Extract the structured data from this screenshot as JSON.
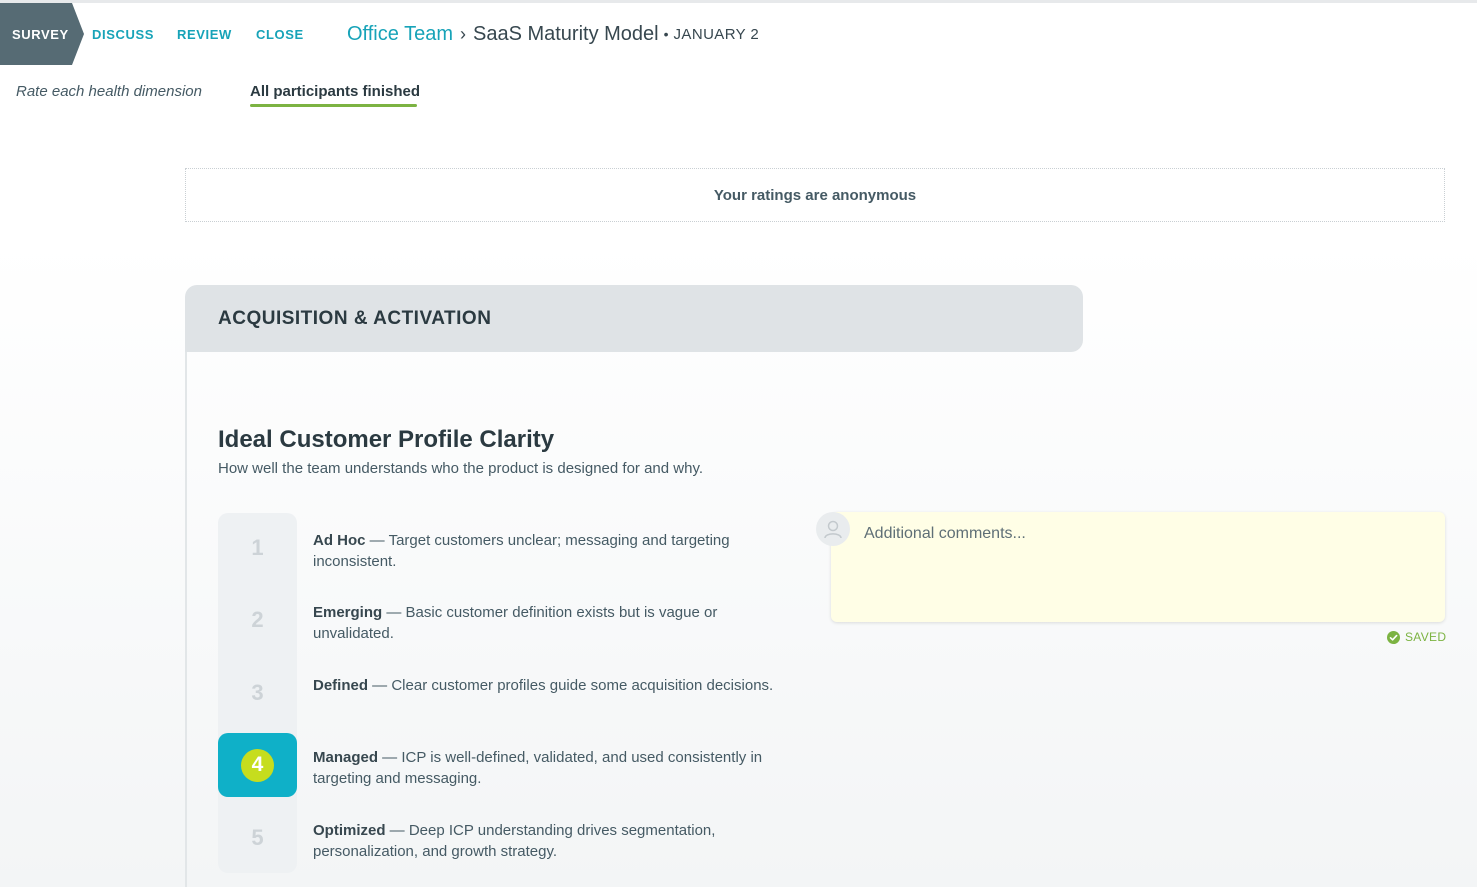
{
  "nav": {
    "steps": [
      {
        "label": "SURVEY"
      },
      {
        "label": "DISCUSS"
      },
      {
        "label": "REVIEW"
      },
      {
        "label": "CLOSE"
      }
    ],
    "breadcrumb": {
      "team": "Office Team",
      "separator": "›",
      "model": "SaaS Maturity Model",
      "dot": "•",
      "date": "JANUARY 2"
    }
  },
  "subheader": {
    "hint": "Rate each health dimension",
    "status": "All participants finished"
  },
  "notice": "Your ratings are anonymous",
  "section": {
    "title": "ACQUISITION & ACTIVATION",
    "dimension": {
      "title": "Ideal Customer Profile Clarity",
      "description": "How well the team understands who the product is designed for and why.",
      "selected": 4,
      "ratings": [
        {
          "num": "1",
          "label": "Ad Hoc",
          "text": " — Target customers unclear; messaging and targeting inconsistent."
        },
        {
          "num": "2",
          "label": "Emerging",
          "text": " — Basic customer definition exists but is vague or unvalidated."
        },
        {
          "num": "3",
          "label": "Defined",
          "text": " — Clear customer profiles guide some acquisition decisions."
        },
        {
          "num": "4",
          "label": "Managed",
          "text": " — ICP is well-defined, validated, and used consistently in targeting and messaging."
        },
        {
          "num": "5",
          "label": "Optimized",
          "text": " — Deep ICP understanding drives segmentation, personalization, and growth strategy."
        }
      ]
    },
    "comments": {
      "placeholder": "Additional comments...",
      "value": "",
      "saved_label": "SAVED"
    }
  },
  "colors": {
    "accent": "#17a3b8",
    "active_step": "#566b74",
    "selected_rating": "#0fb0c8",
    "selected_badge": "#c6dd1e",
    "success": "#7cb342",
    "comment_bg": "#fffee6"
  },
  "icons": {
    "avatar": "user-avatar-icon",
    "saved": "check-circle-icon",
    "breadcrumb_separator": "chevron-right-icon"
  }
}
